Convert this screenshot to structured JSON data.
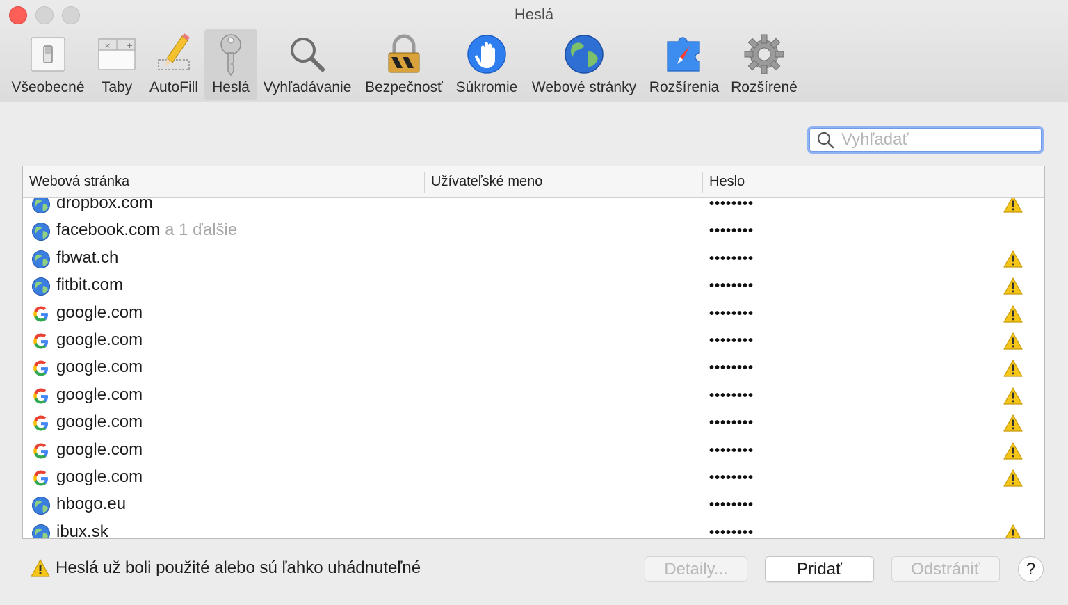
{
  "window": {
    "title": "Heslá"
  },
  "toolbar": {
    "items": [
      {
        "label": "Všeobecné",
        "icon": "switch-icon"
      },
      {
        "label": "Taby",
        "icon": "tabs-icon"
      },
      {
        "label": "AutoFill",
        "icon": "pencil-icon"
      },
      {
        "label": "Heslá",
        "icon": "key-icon",
        "selected": true
      },
      {
        "label": "Vyhľadávanie",
        "icon": "magnifier-icon"
      },
      {
        "label": "Bezpečnosť",
        "icon": "lock-icon"
      },
      {
        "label": "Súkromie",
        "icon": "hand-icon"
      },
      {
        "label": "Webové stránky",
        "icon": "globe-icon"
      },
      {
        "label": "Rozšírenia",
        "icon": "puzzle-icon"
      },
      {
        "label": "Rozšírené",
        "icon": "gear-icon"
      }
    ]
  },
  "search": {
    "placeholder": "Vyhľadať",
    "value": ""
  },
  "table": {
    "columns": [
      "Webová stránka",
      "Užívateľské meno",
      "Heslo"
    ],
    "rows": [
      {
        "site": "dropbox.com",
        "more": "",
        "username": "",
        "password": "••••••••",
        "icon": "globe-icon",
        "warning": true
      },
      {
        "site": "facebook.com",
        "more": " a 1 ďalšie",
        "username": "",
        "password": "••••••••",
        "icon": "globe-icon",
        "warning": false
      },
      {
        "site": "fbwat.ch",
        "more": "",
        "username": "",
        "password": "••••••••",
        "icon": "globe-icon",
        "warning": true
      },
      {
        "site": "fitbit.com",
        "more": "",
        "username": "",
        "password": "••••••••",
        "icon": "globe-icon",
        "warning": true
      },
      {
        "site": "google.com",
        "more": "",
        "username": "",
        "password": "••••••••",
        "icon": "google-icon",
        "warning": true
      },
      {
        "site": "google.com",
        "more": "",
        "username": "",
        "password": "••••••••",
        "icon": "google-icon",
        "warning": true
      },
      {
        "site": "google.com",
        "more": "",
        "username": "",
        "password": "••••••••",
        "icon": "google-icon",
        "warning": true
      },
      {
        "site": "google.com",
        "more": "",
        "username": "",
        "password": "••••••••",
        "icon": "google-icon",
        "warning": true
      },
      {
        "site": "google.com",
        "more": "",
        "username": "",
        "password": "••••••••",
        "icon": "google-icon",
        "warning": true
      },
      {
        "site": "google.com",
        "more": "",
        "username": "",
        "password": "••••••••",
        "icon": "google-icon",
        "warning": true
      },
      {
        "site": "google.com",
        "more": "",
        "username": "",
        "password": "••••••••",
        "icon": "google-icon",
        "warning": true
      },
      {
        "site": "hbogo.eu",
        "more": "",
        "username": "",
        "password": "••••••••",
        "icon": "globe-icon",
        "warning": false
      },
      {
        "site": "ibux.sk",
        "more": "",
        "username": "",
        "password": "••••••••",
        "icon": "globe-icon",
        "warning": true
      }
    ]
  },
  "footer": {
    "warning_text": "Heslá už boli použité alebo sú ľahko uhádnuteľné",
    "details_label": "Detaily...",
    "add_label": "Pridať",
    "remove_label": "Odstrániť",
    "help_label": "?"
  },
  "colors": {
    "close_button": "#fc5f57",
    "focus_ring": "#8fb3f2",
    "warning": "#f5c518"
  }
}
